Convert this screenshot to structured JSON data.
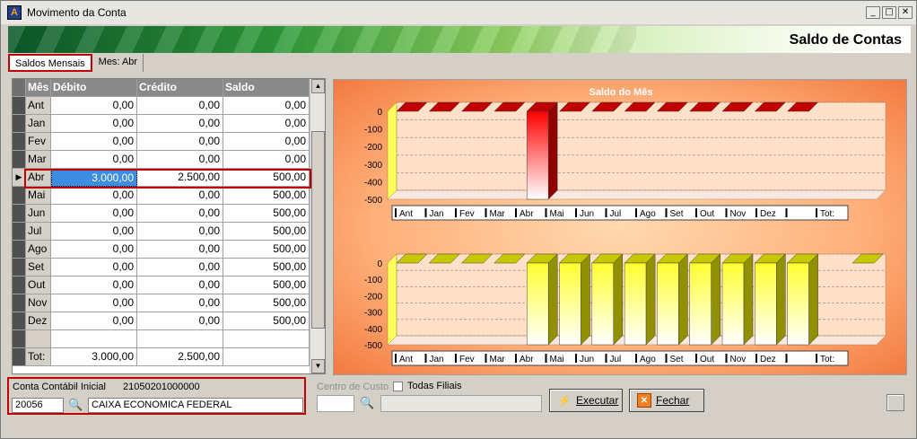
{
  "window": {
    "title": "Movimento da Conta",
    "controls": [
      "_",
      "□",
      "✕"
    ]
  },
  "banner": {
    "title": "Saldo de Contas"
  },
  "tabs": [
    {
      "label": "Saldos Mensais"
    },
    {
      "label": "Mes: Abr"
    }
  ],
  "grid": {
    "headers": {
      "mes": "Mês",
      "debito": "Débito",
      "credito": "Crédito",
      "saldo": "Saldo"
    },
    "rows": [
      {
        "mes": "Ant",
        "debito": "0,00",
        "credito": "0,00",
        "saldo": "0,00"
      },
      {
        "mes": "Jan",
        "debito": "0,00",
        "credito": "0,00",
        "saldo": "0,00"
      },
      {
        "mes": "Fev",
        "debito": "0,00",
        "credito": "0,00",
        "saldo": "0,00"
      },
      {
        "mes": "Mar",
        "debito": "0,00",
        "credito": "0,00",
        "saldo": "0,00"
      },
      {
        "mes": "Abr",
        "debito": "3.000,00",
        "credito": "2.500,00",
        "saldo": "500,00"
      },
      {
        "mes": "Mai",
        "debito": "0,00",
        "credito": "0,00",
        "saldo": "500,00"
      },
      {
        "mes": "Jun",
        "debito": "0,00",
        "credito": "0,00",
        "saldo": "500,00"
      },
      {
        "mes": "Jul",
        "debito": "0,00",
        "credito": "0,00",
        "saldo": "500,00"
      },
      {
        "mes": "Ago",
        "debito": "0,00",
        "credito": "0,00",
        "saldo": "500,00"
      },
      {
        "mes": "Set",
        "debito": "0,00",
        "credito": "0,00",
        "saldo": "500,00"
      },
      {
        "mes": "Out",
        "debito": "0,00",
        "credito": "0,00",
        "saldo": "500,00"
      },
      {
        "mes": "Nov",
        "debito": "0,00",
        "credito": "0,00",
        "saldo": "500,00"
      },
      {
        "mes": "Dez",
        "debito": "0,00",
        "credito": "0,00",
        "saldo": "500,00"
      },
      {
        "mes": "",
        "debito": "",
        "credito": "",
        "saldo": ""
      },
      {
        "mes": "Tot:",
        "debito": "3.000,00",
        "credito": "2.500,00",
        "saldo": ""
      }
    ]
  },
  "chart_data": [
    {
      "type": "bar",
      "title": "Saldo do Mês",
      "categories": [
        "Ant",
        "Jan",
        "Fev",
        "Mar",
        "Abr",
        "Mai",
        "Jun",
        "Jul",
        "Ago",
        "Set",
        "Out",
        "Nov",
        "Dez",
        "",
        "Tot:"
      ],
      "values": [
        0,
        0,
        0,
        0,
        -500,
        0,
        0,
        0,
        0,
        0,
        0,
        0,
        0,
        null,
        null
      ],
      "ylim": [
        -500,
        0
      ],
      "yticks": [
        "0",
        "-100",
        "-200",
        "-300",
        "-400",
        "-500"
      ],
      "color": "#e00000",
      "grid": true
    },
    {
      "type": "bar",
      "title": "",
      "categories": [
        "Ant",
        "Jan",
        "Fev",
        "Mar",
        "Abr",
        "Mai",
        "Jun",
        "Jul",
        "Ago",
        "Set",
        "Out",
        "Nov",
        "Dez",
        "",
        "Tot:"
      ],
      "values": [
        0,
        0,
        0,
        0,
        -500,
        -500,
        -500,
        -500,
        -500,
        -500,
        -500,
        -500,
        -500,
        null,
        0
      ],
      "ylim": [
        -500,
        0
      ],
      "yticks": [
        "0",
        "-100",
        "-200",
        "-300",
        "-400",
        "-500"
      ],
      "color": "#ffff40",
      "grid": true
    }
  ],
  "account": {
    "label": "Conta Contábil Inicial",
    "code": "21050201000000",
    "number": "20056",
    "name": "CAIXA ECONOMICA FEDERAL"
  },
  "cost_center": {
    "label": "Centro de Custo",
    "all_branches_label": "Todas Filiais"
  },
  "buttons": {
    "execute": "Executar",
    "close": "Fechar"
  }
}
